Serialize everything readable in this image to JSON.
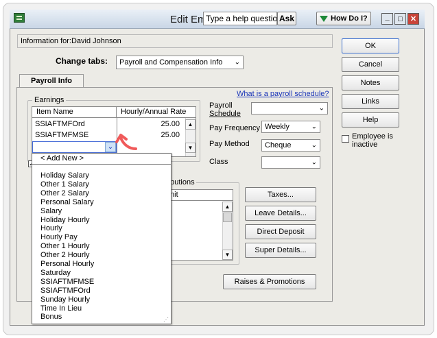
{
  "window": {
    "title": "Edit Em",
    "help_placeholder": "Type a help question",
    "ask_label": "Ask",
    "how_do_i_label": "How Do I?",
    "min_label": "_",
    "max_label": "□",
    "close_label": "✕"
  },
  "info": {
    "text": "Information for:David Johnson"
  },
  "change_tabs": {
    "label": "Change tabs:",
    "value": "Payroll and Compensation Info"
  },
  "tab": {
    "label": "Payroll Info"
  },
  "schedule_link": "What is a payroll schedule?",
  "earnings": {
    "group_label": "Earnings",
    "columns": [
      "Item Name",
      "Hourly/Annual Rate"
    ],
    "rows": [
      {
        "name": "SSIAFTMFOrd",
        "rate": "25.00"
      },
      {
        "name": "SSIAFTMFMSE",
        "rate": "25.00"
      }
    ]
  },
  "fields": {
    "payroll_schedule": {
      "label_line1": "Payroll",
      "label_line2": "Schedule",
      "value": ""
    },
    "pay_frequency": {
      "label": "Pay Frequency",
      "value": "Weekly"
    },
    "pay_method": {
      "label": "Pay Method",
      "value": "Cheque"
    },
    "class": {
      "label": "Class",
      "value": ""
    }
  },
  "distributions": {
    "label": "ributions",
    "column": "mit"
  },
  "dropdown": {
    "add_new": "< Add New >",
    "items": [
      "Holiday Salary",
      "Other 1 Salary",
      "Other 2 Salary",
      "Personal Salary",
      "Salary",
      "Holiday Hourly",
      "Hourly",
      "Hourly Pay",
      "Other 1 Hourly",
      "Other 2 Hourly",
      "Personal Hourly",
      "Saturday",
      "SSIAFTMFMSE",
      "SSIAFTMFOrd",
      "Sunday Hourly",
      "Time In Lieu",
      "Bonus"
    ]
  },
  "action_buttons": {
    "taxes": "Taxes...",
    "leave_details": "Leave Details...",
    "direct_deposit": "Direct Deposit",
    "super_details": "Super Details...",
    "raises_promotions": "Raises & Promotions"
  },
  "side_buttons": {
    "ok": "OK",
    "cancel": "Cancel",
    "notes": "Notes",
    "links": "Links",
    "help": "Help"
  },
  "inactive": {
    "label_line1": "Employee is",
    "label_line2": "inactive"
  },
  "colors": {
    "accent_arrow": "#f05a5a",
    "link": "#1a35b8",
    "close_button": "#c9443a"
  },
  "icons": [
    "app-icon",
    "how-do-i-arrow-icon",
    "chevron-down-icon",
    "annotation-arrow-icon",
    "resize-grip-icon"
  ]
}
